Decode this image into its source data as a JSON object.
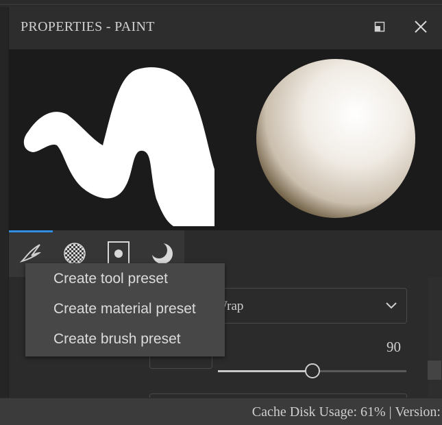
{
  "panel": {
    "title": "PROPERTIES - PAINT",
    "icons": [
      "maximize-icon",
      "close-icon"
    ]
  },
  "preview": {
    "icons": [
      "brush-stroke-preview-icon",
      "material-sphere-preview-icon"
    ]
  },
  "tabs": [
    {
      "name": "tool-tab",
      "icon": "brush-tool-icon",
      "active": true
    },
    {
      "name": "material-tab",
      "icon": "checker-material-icon"
    },
    {
      "name": "alpha-tab",
      "icon": "stencil-alpha-icon"
    },
    {
      "name": "stencil-tab",
      "icon": "moon-stencil-icon"
    }
  ],
  "content": {
    "select_value": "Wrap",
    "slider_value": "90",
    "slider_fraction": 0.5
  },
  "context_menu": {
    "items": [
      "Create tool preset",
      "Create material preset",
      "Create brush preset"
    ]
  },
  "status": {
    "text": "Cache Disk Usage:  61% | Version:"
  },
  "colors": {
    "accent": "#2f8de4",
    "panel_bg": "#2f2f2f",
    "preview_bg": "#1b1b1b",
    "menu_bg": "#474747"
  }
}
